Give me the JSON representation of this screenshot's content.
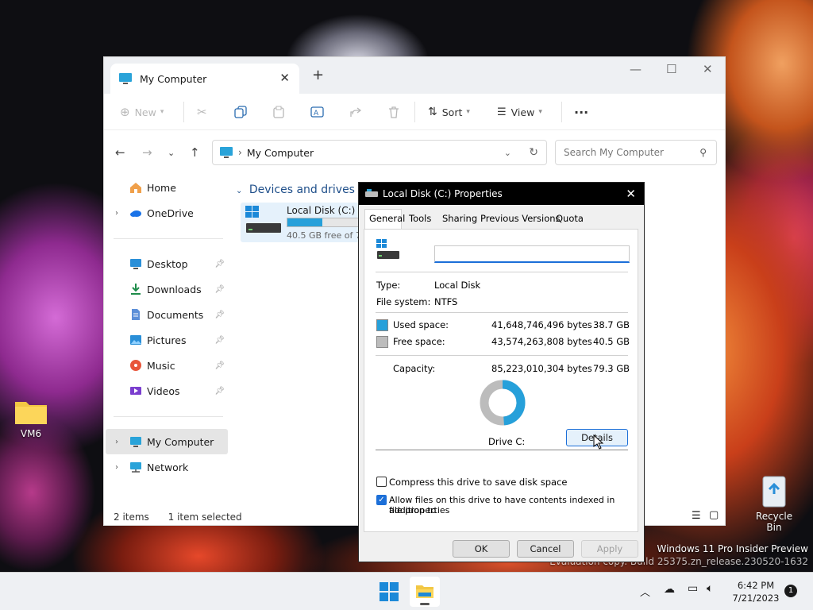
{
  "desktop": {
    "folder_label": "VM6",
    "recycle_label": "Recycle Bin",
    "watermark_line1": "Windows 11 Pro Insider Preview",
    "watermark_line2": "Evaluation copy. Build 25375.zn_release.230520-1632"
  },
  "explorer": {
    "tab_title": "My Computer",
    "toolbar": {
      "new": "New",
      "sort": "Sort",
      "view": "View"
    },
    "address": "My Computer",
    "search_placeholder": "Search My Computer",
    "sidebar": {
      "home": "Home",
      "onedrive": "OneDrive",
      "desktop": "Desktop",
      "downloads": "Downloads",
      "documents": "Documents",
      "pictures": "Pictures",
      "music": "Music",
      "videos": "Videos",
      "mycomputer": "My Computer",
      "network": "Network"
    },
    "section_header": "Devices and drives",
    "drive": {
      "name": "Local Disk (C:)",
      "free_text": "40.5 GB free of 79",
      "used_fraction": 0.488
    },
    "status": {
      "items": "2 items",
      "selected": "1 item selected"
    }
  },
  "dialog": {
    "title": "Local Disk (C:) Properties",
    "tabs": [
      "General",
      "Tools",
      "Sharing",
      "Previous Versions",
      "Quota"
    ],
    "label_value": "",
    "type_label": "Type:",
    "type_value": "Local Disk",
    "fs_label": "File system:",
    "fs_value": "NTFS",
    "used_label": "Used space:",
    "used_bytes": "41,648,746,496 bytes",
    "used_gb": "38.7 GB",
    "free_label": "Free space:",
    "free_bytes": "43,574,263,808 bytes",
    "free_gb": "40.5 GB",
    "cap_label": "Capacity:",
    "cap_bytes": "85,223,010,304 bytes",
    "cap_gb": "79.3 GB",
    "drive_label": "Drive C:",
    "details_button": "Details",
    "compress_label": "Compress this drive to save disk space",
    "index_label_1": "Allow files on this drive to have contents indexed in addition to",
    "index_label_2": "file properties",
    "ok": "OK",
    "cancel": "Cancel",
    "apply": "Apply",
    "colors": {
      "used": "#26a0da",
      "free": "#bcbcbc"
    },
    "used_fraction": 0.488
  },
  "taskbar": {
    "time": "6:42 PM",
    "date": "7/21/2023",
    "notif_count": "1"
  }
}
